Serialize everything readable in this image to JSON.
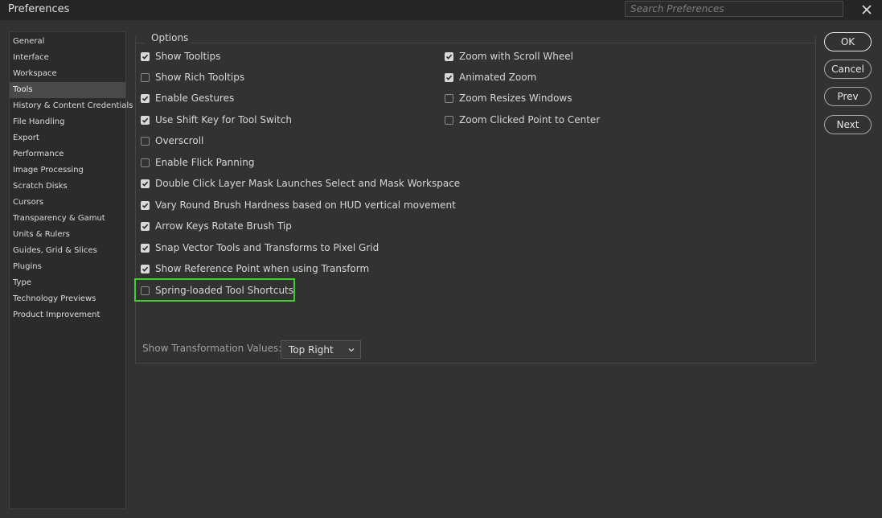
{
  "window": {
    "title": "Preferences",
    "search_placeholder": "Search Preferences",
    "close_icon": "close-icon"
  },
  "sidebar": {
    "items": [
      {
        "label": "General"
      },
      {
        "label": "Interface"
      },
      {
        "label": "Workspace"
      },
      {
        "label": "Tools",
        "selected": true
      },
      {
        "label": "History & Content Credentials"
      },
      {
        "label": "File Handling"
      },
      {
        "label": "Export"
      },
      {
        "label": "Performance"
      },
      {
        "label": "Image Processing"
      },
      {
        "label": "Scratch Disks"
      },
      {
        "label": "Cursors"
      },
      {
        "label": "Transparency & Gamut"
      },
      {
        "label": "Units & Rulers"
      },
      {
        "label": "Guides, Grid & Slices"
      },
      {
        "label": "Plugins"
      },
      {
        "label": "Type"
      },
      {
        "label": "Technology Previews"
      },
      {
        "label": "Product Improvement"
      }
    ]
  },
  "options": {
    "title": "Options",
    "left": [
      {
        "label": "Show Tooltips",
        "checked": true
      },
      {
        "label": "Show Rich Tooltips",
        "checked": false
      },
      {
        "label": "Enable Gestures",
        "checked": true
      },
      {
        "label": "Use Shift Key for Tool Switch",
        "checked": true
      },
      {
        "label": "Overscroll",
        "checked": false
      },
      {
        "label": "Enable Flick Panning",
        "checked": false
      },
      {
        "label": "Double Click Layer Mask Launches Select and Mask Workspace",
        "checked": true
      },
      {
        "label": "Vary Round Brush Hardness based on HUD vertical movement",
        "checked": true
      },
      {
        "label": "Arrow Keys Rotate Brush Tip",
        "checked": true
      },
      {
        "label": "Snap Vector Tools and Transforms to Pixel Grid",
        "checked": true
      },
      {
        "label": "Show Reference Point when using Transform",
        "checked": true
      },
      {
        "label": "Spring-loaded Tool Shortcuts",
        "checked": false
      }
    ],
    "right": [
      {
        "label": "Zoom with Scroll Wheel",
        "checked": true
      },
      {
        "label": "Animated Zoom",
        "checked": true
      },
      {
        "label": "Zoom Resizes Windows",
        "checked": false
      },
      {
        "label": "Zoom Clicked Point to Center",
        "checked": false
      }
    ],
    "transformation_values": {
      "label": "Show Transformation Values:",
      "selected": "Top Right"
    }
  },
  "buttons": {
    "ok": "OK",
    "cancel": "Cancel",
    "prev": "Prev",
    "next": "Next"
  },
  "colors": {
    "highlight": "#3ecf2a",
    "background": "#323232"
  }
}
